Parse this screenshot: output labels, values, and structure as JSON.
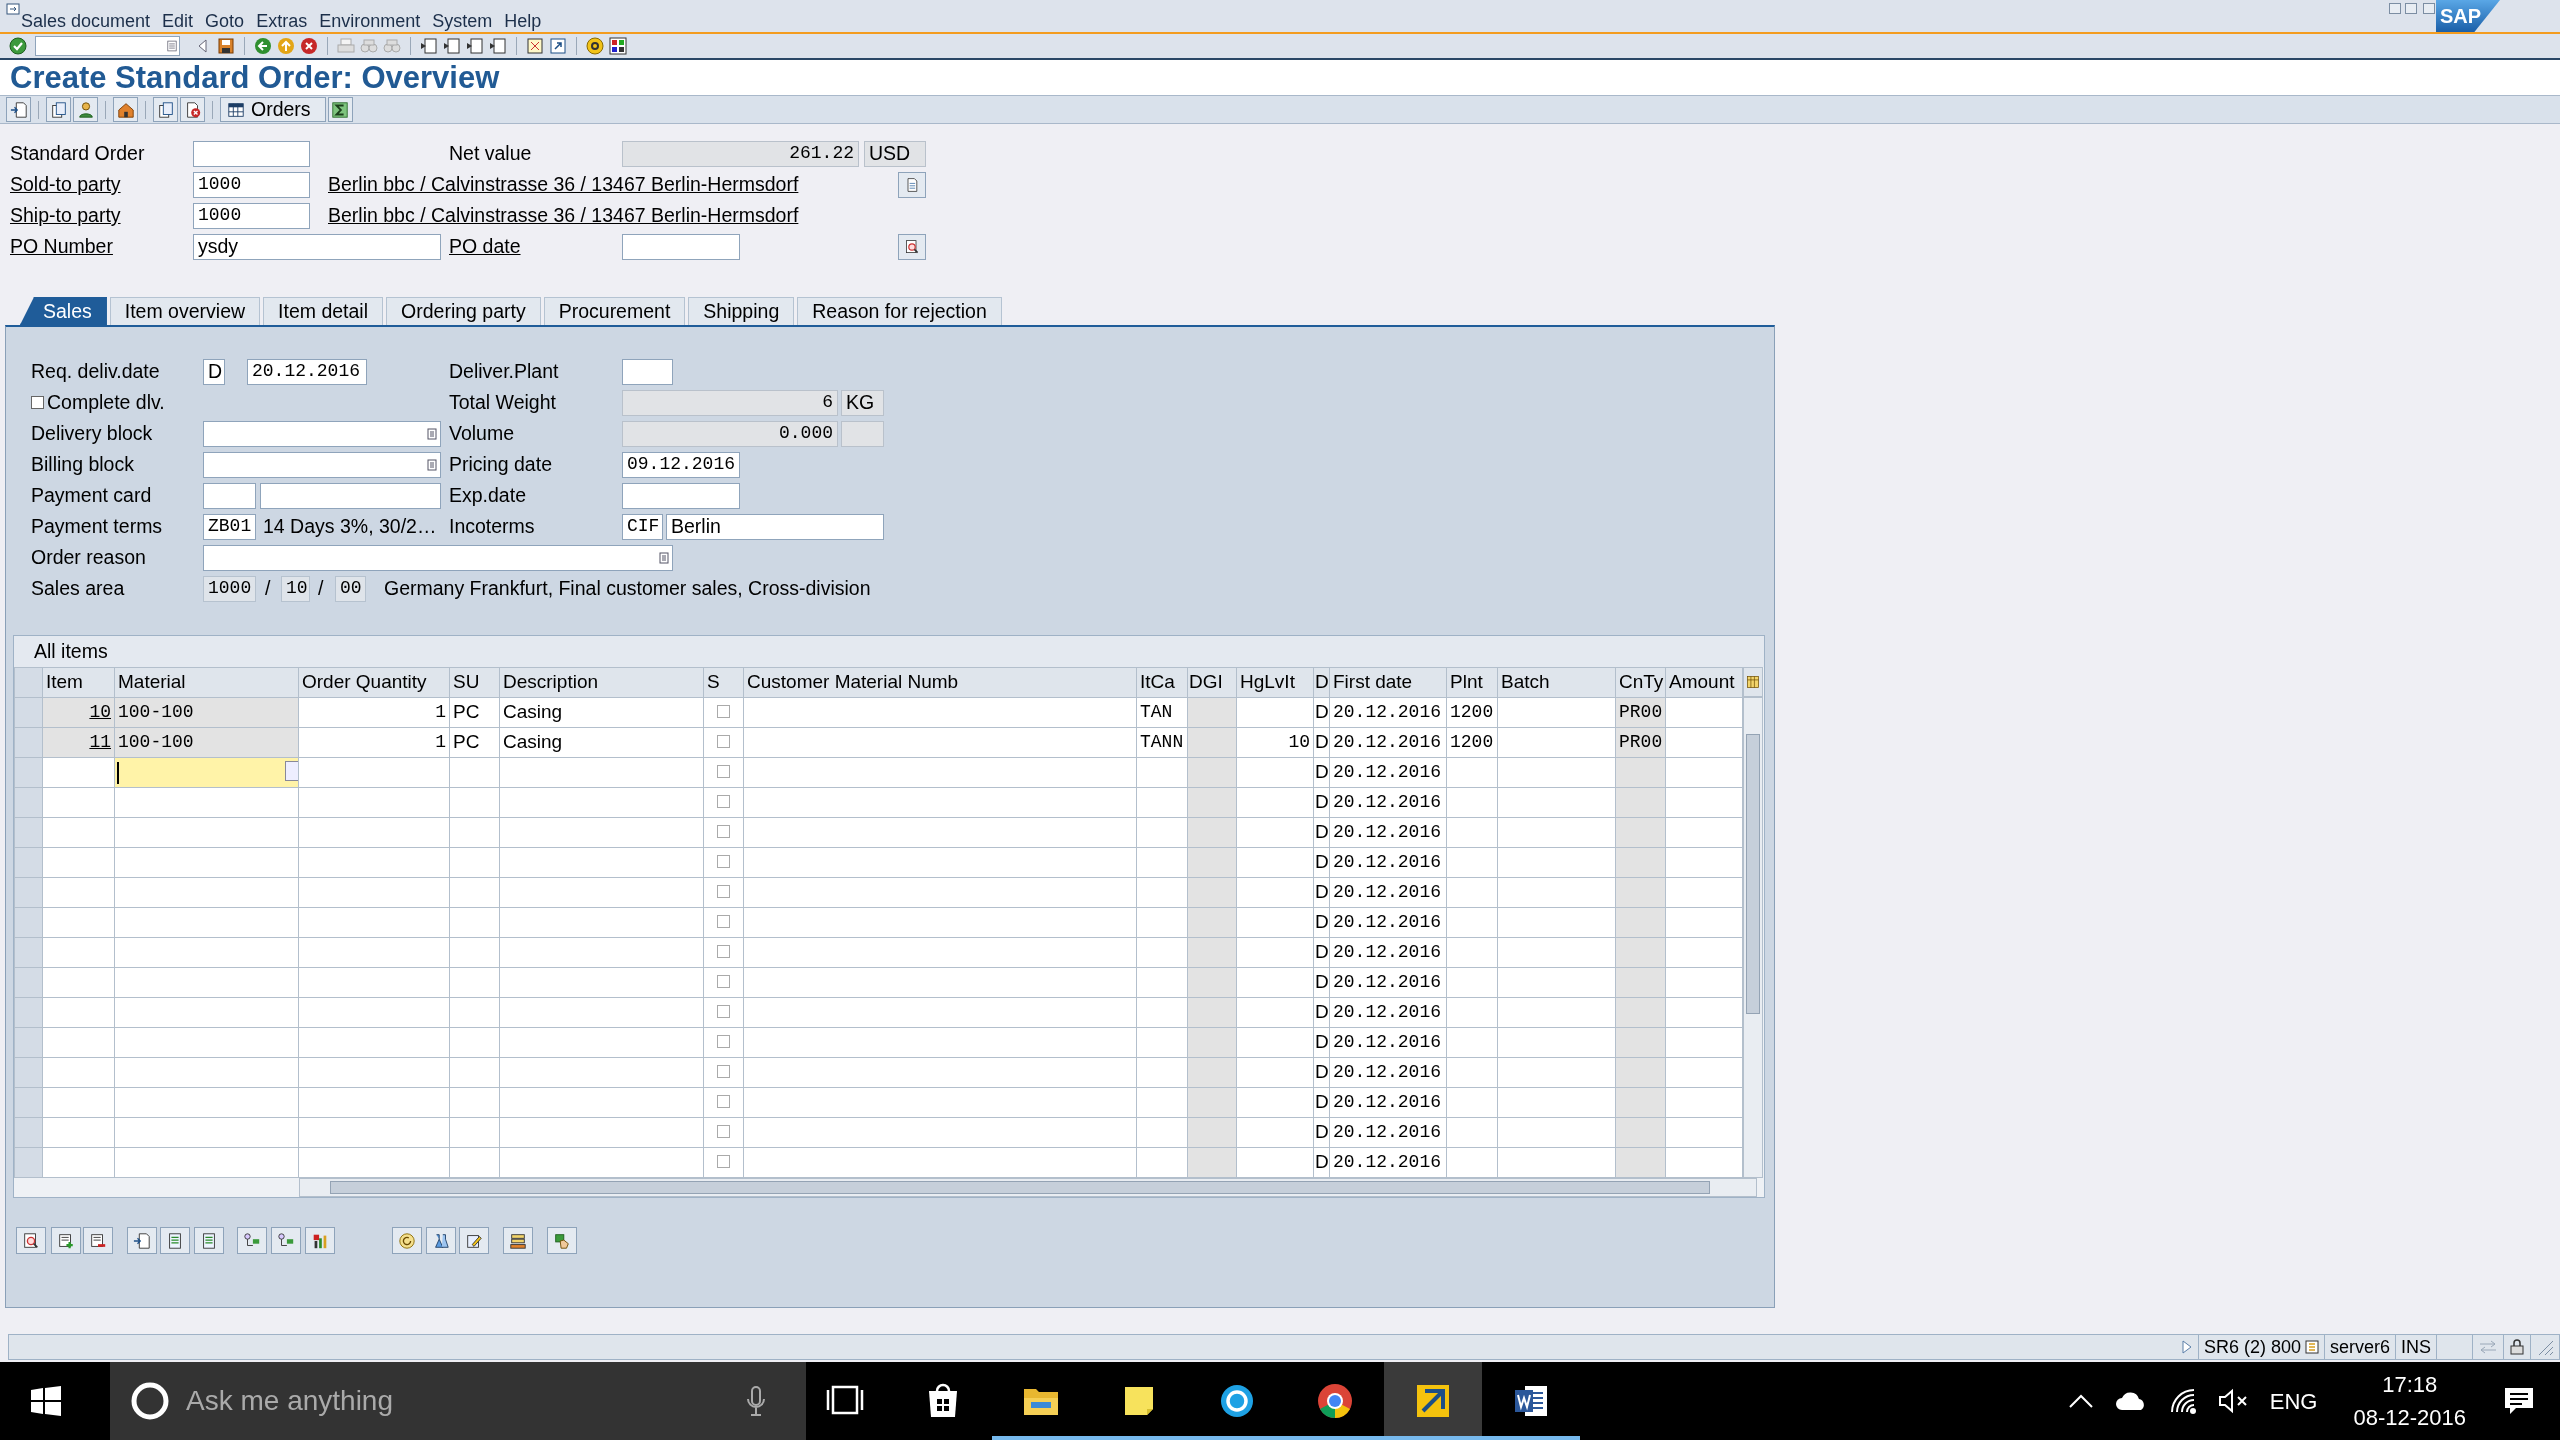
{
  "window": {
    "logo": "SAP"
  },
  "menu": [
    "Sales document",
    "Edit",
    "Goto",
    "Extras",
    "Environment",
    "System",
    "Help"
  ],
  "title": "Create Standard Order: Overview",
  "app_toolbar": {
    "orders_button": "Orders"
  },
  "header": {
    "standard_order": {
      "label": "Standard Order"
    },
    "net_value": {
      "label": "Net value",
      "value": "261.22",
      "currency": "USD"
    },
    "sold_to": {
      "label": "Sold-to party",
      "value": "1000",
      "address": "Berlin bbc / Calvinstrasse 36 / 13467 Berlin-Hermsdorf"
    },
    "ship_to": {
      "label": "Ship-to party",
      "value": "1000",
      "address": "Berlin bbc / Calvinstrasse 36 / 13467 Berlin-Hermsdorf"
    },
    "po_number": {
      "label": "PO Number",
      "value": "ysdy"
    },
    "po_date": {
      "label": "PO date"
    }
  },
  "tabs": [
    {
      "label": "Sales",
      "selected": true
    },
    {
      "label": "Item overview",
      "selected": false
    },
    {
      "label": "Item detail",
      "selected": false
    },
    {
      "label": "Ordering party",
      "selected": false
    },
    {
      "label": "Procurement",
      "selected": false
    },
    {
      "label": "Shipping",
      "selected": false
    },
    {
      "label": "Reason for rejection",
      "selected": false
    }
  ],
  "sales": {
    "req_deliv_date": {
      "label": "Req. deliv.date",
      "format": "D",
      "value": "20.12.2016"
    },
    "deliver_plant": {
      "label": "Deliver.Plant"
    },
    "complete_dlv": {
      "label": "Complete dlv.",
      "checked": false
    },
    "total_weight": {
      "label": "Total Weight",
      "value": "6",
      "unit": "KG"
    },
    "delivery_block": {
      "label": "Delivery block"
    },
    "volume": {
      "label": "Volume",
      "value": "0.000"
    },
    "billing_block": {
      "label": "Billing block"
    },
    "pricing_date": {
      "label": "Pricing date",
      "value": "09.12.2016"
    },
    "payment_card": {
      "label": "Payment card"
    },
    "exp_date": {
      "label": "Exp.date"
    },
    "payment_terms": {
      "label": "Payment terms",
      "code": "ZB01",
      "text": "14 Days 3%, 30/2…"
    },
    "incoterms": {
      "label": "Incoterms",
      "code": "CIF",
      "place": "Berlin"
    },
    "order_reason": {
      "label": "Order reason"
    },
    "sales_area": {
      "label": "Sales area",
      "org": "1000",
      "sep1": "/",
      "channel": "10",
      "sep2": "/",
      "division": "00",
      "text": "Germany Frankfurt, Final customer sales, Cross-division"
    }
  },
  "items": {
    "title": "All items",
    "columns": [
      "Item",
      "Material",
      "Order Quantity",
      "SU",
      "Description",
      "S",
      "Customer Material Numb",
      "ItCa",
      "DGI",
      "HgLvIt",
      "D",
      "First date",
      "Plnt",
      "Batch",
      "CnTy",
      "Amount"
    ],
    "rows": [
      {
        "locked": true,
        "s_checked": false,
        "item": "10",
        "material": "100-100",
        "quantity": "1",
        "su": "PC",
        "description": "Casing",
        "itca": "TAN",
        "d": "D",
        "first_date": "20.12.2016",
        "plnt": "1200",
        "cnty": "PR00"
      },
      {
        "locked": true,
        "s_checked": false,
        "item": "11",
        "material": "100-100",
        "quantity": "1",
        "su": "PC",
        "description": "Casing",
        "itca": "TANN",
        "hglvit": "10",
        "d": "D",
        "first_date": "20.12.2016",
        "plnt": "1200",
        "cnty": "PR00"
      },
      {
        "locked": false,
        "focused": true,
        "s_checked": false,
        "d": "D",
        "first_date": "20.12.2016"
      },
      {
        "locked": false,
        "s_checked": false,
        "d": "D",
        "first_date": "20.12.2016"
      },
      {
        "locked": false,
        "s_checked": false,
        "d": "D",
        "first_date": "20.12.2016"
      },
      {
        "locked": false,
        "s_checked": false,
        "d": "D",
        "first_date": "20.12.2016"
      },
      {
        "locked": false,
        "s_checked": false,
        "d": "D",
        "first_date": "20.12.2016"
      },
      {
        "locked": false,
        "s_checked": false,
        "d": "D",
        "first_date": "20.12.2016"
      },
      {
        "locked": false,
        "s_checked": false,
        "d": "D",
        "first_date": "20.12.2016"
      },
      {
        "locked": false,
        "s_checked": false,
        "d": "D",
        "first_date": "20.12.2016"
      },
      {
        "locked": false,
        "s_checked": false,
        "d": "D",
        "first_date": "20.12.2016"
      },
      {
        "locked": false,
        "s_checked": false,
        "d": "D",
        "first_date": "20.12.2016"
      },
      {
        "locked": false,
        "s_checked": false,
        "d": "D",
        "first_date": "20.12.2016"
      },
      {
        "locked": false,
        "s_checked": false,
        "d": "D",
        "first_date": "20.12.2016"
      },
      {
        "locked": false,
        "s_checked": false,
        "d": "D",
        "first_date": "20.12.2016"
      },
      {
        "locked": false,
        "s_checked": false,
        "d": "D",
        "first_date": "20.12.2016"
      }
    ]
  },
  "status_bar": {
    "system": "SR6 (2) 800",
    "server": "server6",
    "mode": "INS"
  },
  "taskbar": {
    "search_placeholder": "Ask me anything",
    "apps": [
      {
        "kind": "task_view",
        "running": false,
        "active": false
      },
      {
        "kind": "store",
        "running": false,
        "active": false
      },
      {
        "kind": "explorer",
        "running": true,
        "active": false
      },
      {
        "kind": "notes",
        "running": true,
        "active": false
      },
      {
        "kind": "chat",
        "running": true,
        "active": false
      },
      {
        "kind": "browser",
        "running": true,
        "active": false
      },
      {
        "kind": "sap",
        "running": true,
        "active": true
      },
      {
        "kind": "word",
        "running": true,
        "active": false
      }
    ],
    "language": "ENG",
    "time": "17:18",
    "date": "08-12-2016"
  }
}
